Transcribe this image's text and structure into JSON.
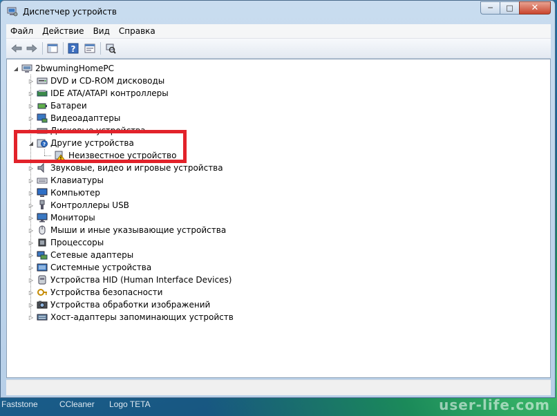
{
  "window": {
    "title": "Диспетчер устройств"
  },
  "caption": {
    "minimize": "─",
    "maximize": "□",
    "close": "✕"
  },
  "menu": [
    "Файл",
    "Действие",
    "Вид",
    "Справка"
  ],
  "toolbar": {
    "icons": [
      "back-icon",
      "forward-icon",
      "show-hide-console-tree-icon",
      "help-icon",
      "properties-icon",
      "scan-hardware-icon"
    ]
  },
  "tree": {
    "root": "2bwumingHomePC",
    "items": [
      {
        "label": "DVD и CD-ROM дисководы",
        "icon": "dvd-drive-icon",
        "expanded": false
      },
      {
        "label": "IDE ATA/ATAPI контроллеры",
        "icon": "ide-controller-icon",
        "expanded": false
      },
      {
        "label": "Батареи",
        "icon": "battery-icon",
        "expanded": false
      },
      {
        "label": "Видеоадаптеры",
        "icon": "display-adapter-icon",
        "expanded": false
      },
      {
        "label": "Дисковые устройства",
        "icon": "disk-drive-icon",
        "expanded": false
      },
      {
        "label": "Другие устройства",
        "icon": "other-devices-icon",
        "expanded": true,
        "children": [
          {
            "label": "Неизвестное устройство",
            "icon": "unknown-device-warning-icon"
          }
        ]
      },
      {
        "label": "Звуковые, видео и игровые устройства",
        "icon": "sound-icon",
        "expanded": false
      },
      {
        "label": "Клавиатуры",
        "icon": "keyboard-icon",
        "expanded": false
      },
      {
        "label": "Компьютер",
        "icon": "computer-icon",
        "expanded": false
      },
      {
        "label": "Контроллеры USB",
        "icon": "usb-icon",
        "expanded": false
      },
      {
        "label": "Мониторы",
        "icon": "monitor-icon",
        "expanded": false
      },
      {
        "label": "Мыши и иные указывающие устройства",
        "icon": "mouse-icon",
        "expanded": false
      },
      {
        "label": "Процессоры",
        "icon": "processor-icon",
        "expanded": false
      },
      {
        "label": "Сетевые адаптеры",
        "icon": "network-adapter-icon",
        "expanded": false
      },
      {
        "label": "Системные устройства",
        "icon": "system-devices-icon",
        "expanded": false
      },
      {
        "label": "Устройства HID (Human Interface Devices)",
        "icon": "hid-icon",
        "expanded": false
      },
      {
        "label": "Устройства безопасности",
        "icon": "security-devices-icon",
        "expanded": false
      },
      {
        "label": "Устройства обработки изображений",
        "icon": "imaging-devices-icon",
        "expanded": false
      },
      {
        "label": "Хост-адаптеры запоминающих устройств",
        "icon": "storage-controller-icon",
        "expanded": false
      }
    ]
  },
  "taskbar": {
    "labels": [
      "Faststone",
      "CCleaner",
      "Logo TETA"
    ]
  },
  "watermark": "user-life.com"
}
